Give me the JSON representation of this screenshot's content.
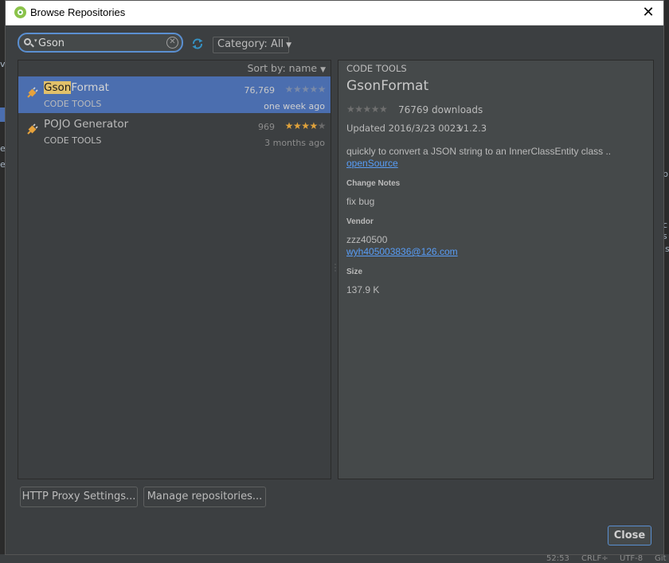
{
  "window": {
    "title": "Browse Repositories"
  },
  "search": {
    "value": "Gson"
  },
  "category": {
    "label": "Category: All"
  },
  "list": {
    "sort_label": "Sort by: name",
    "items": [
      {
        "name_highlight": "Gson",
        "name_rest": "Format",
        "category": "CODE TOOLS",
        "downloads": "76,769",
        "rating_stars": 0,
        "date": "one week ago",
        "selected": true
      },
      {
        "name_highlight": "",
        "name_rest": "POJO Generator",
        "category": "CODE TOOLS",
        "downloads": "969",
        "rating_stars": 4,
        "date": "3 months ago",
        "selected": false
      }
    ]
  },
  "details": {
    "category": "CODE TOOLS",
    "name": "GsonFormat",
    "downloads": "76769 downloads",
    "updated": "Updated 2016/3/23 0023",
    "version": "v1.2.3",
    "description": "quickly to convert a JSON string to an InnerClassEntity class ..",
    "open_source_link": "openSource",
    "change_notes_heading": "Change Notes",
    "change_notes": "fix bug",
    "vendor_heading": "Vendor",
    "vendor_name": "zzz40500",
    "vendor_email": "wyh405003836@126.com",
    "size_heading": "Size",
    "size": "137.9 K"
  },
  "buttons": {
    "proxy": "HTTP Proxy Settings...",
    "repos": "Manage repositories...",
    "close": "Close"
  },
  "background": {
    "left_fragments": [
      "v",
      "ep",
      "ev"
    ],
    "right_fragments": [
      "p",
      "c",
      "s",
      "is"
    ],
    "status_fragments": [
      "",
      "52:53",
      "CRLF÷",
      "UTF-8",
      "Git"
    ]
  },
  "colors": {
    "dialog_bg": "#3c3f41",
    "detail_bg": "#45494a",
    "selection": "#4b6eaf",
    "highlight": "#e2c16a",
    "link": "#589df6",
    "star_on": "#e0a23b"
  }
}
